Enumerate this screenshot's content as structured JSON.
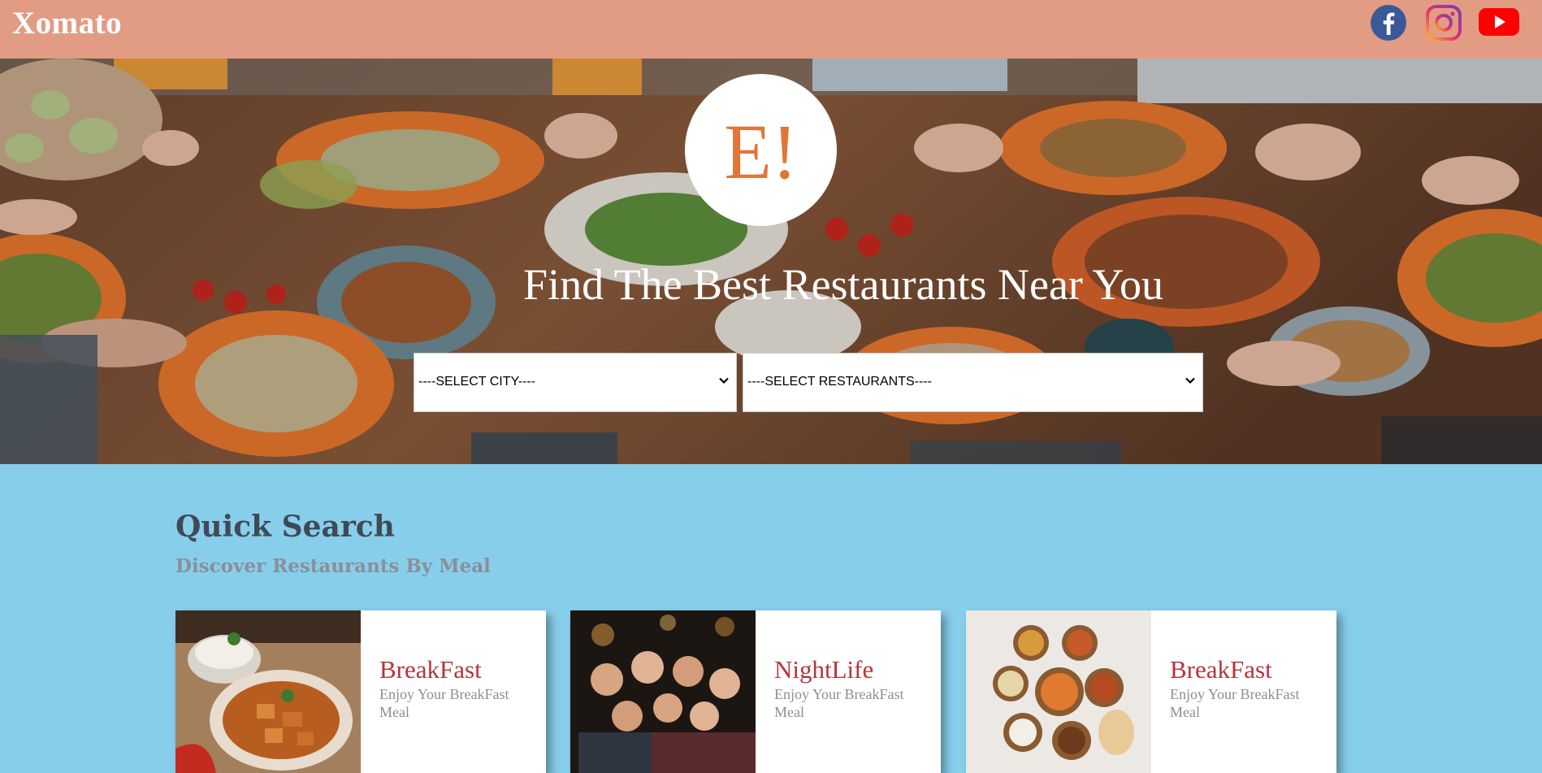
{
  "header": {
    "brand": "Xomato",
    "social": [
      {
        "name": "facebook-icon",
        "color": "#3b5998"
      },
      {
        "name": "instagram-icon",
        "color": "#c13584"
      },
      {
        "name": "youtube-icon",
        "color": "#ff0000"
      }
    ]
  },
  "hero": {
    "logo": "E!",
    "title": "Find The Best Restaurants Near You",
    "city_select": "----SELECT CITY----",
    "restaurant_select": "----SELECT RESTAURANTS----"
  },
  "quick_search": {
    "title": "Quick Search",
    "subtitle": "Discover Restaurants By Meal",
    "cards": [
      {
        "name": "BreakFast",
        "desc": "Enjoy Your BreakFast Meal"
      },
      {
        "name": "NightLife",
        "desc": "Enjoy Your BreakFast Meal"
      },
      {
        "name": "BreakFast",
        "desc": "Enjoy Your BreakFast Meal"
      }
    ]
  },
  "colors": {
    "header_bg": "#e29c84",
    "page_bg": "#87ceeb",
    "logo_accent": "#e07637",
    "card_title": "#b5343b"
  }
}
